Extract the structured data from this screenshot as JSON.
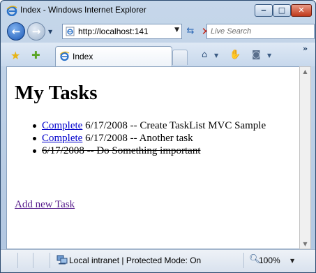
{
  "window": {
    "title": "Index - Windows Internet Explorer",
    "minimize_glyph": "‒",
    "maximize_glyph": "□",
    "close_glyph": "✕"
  },
  "navigation": {
    "back_glyph": "←",
    "forward_glyph": "→",
    "address": "http://localhost:141",
    "search_placeholder": "Live Search"
  },
  "tabs": [
    {
      "label": "Index",
      "icon": "ie-page-icon",
      "active": true
    }
  ],
  "command_bar": {
    "icons": [
      "home-icon",
      "research-hand-icon",
      "feed-icon"
    ]
  },
  "page": {
    "title": "My Tasks",
    "tasks": [
      {
        "link": "Complete",
        "text": "6/17/2008 -- Create TaskList MVC Sample",
        "completed": false
      },
      {
        "link": "Complete",
        "text": "6/17/2008 -- Another task",
        "completed": false
      },
      {
        "link": "",
        "text": "6/17/2008 -- Do Something important",
        "completed": true
      }
    ],
    "add_link": "Add new Task"
  },
  "status_bar": {
    "zone": "Local intranet | Protected Mode: On",
    "zoom": "100%"
  },
  "colors": {
    "link": "#0000cc",
    "visited_link": "#551a8b",
    "chrome": "#c6d7ea"
  }
}
